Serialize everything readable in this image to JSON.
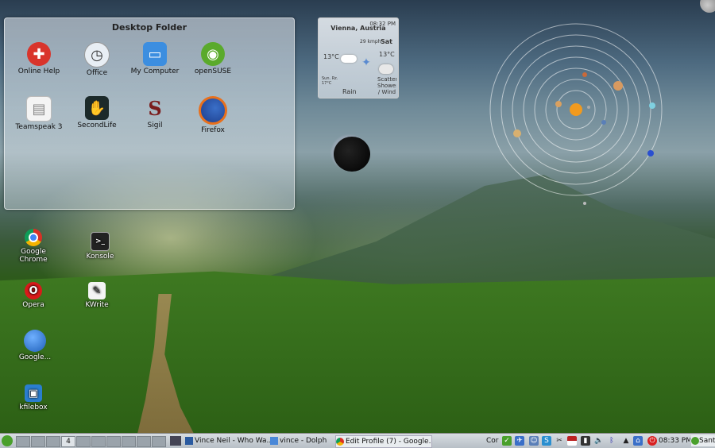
{
  "desktop_folder": {
    "title": "Desktop Folder",
    "icons": [
      {
        "label": "Online Help",
        "icon": "lifebuoy-icon",
        "color": "#d9342b"
      },
      {
        "label": "Office",
        "icon": "clock-icon",
        "color": "#dde6f0"
      },
      {
        "label": "My Computer",
        "icon": "monitor-icon",
        "color": "#3c8ee0"
      },
      {
        "label": "openSUSE",
        "icon": "opensuse-icon",
        "color": "#5aaa2c"
      },
      {
        "label": "Teamspeak 3",
        "icon": "document-icon",
        "color": "#f0f0f0"
      },
      {
        "label": "SecondLife",
        "icon": "hand-icon",
        "color": "#1c2a2a"
      },
      {
        "label": "Sigil",
        "icon": "sigil-icon",
        "color": "#7a1c1c"
      },
      {
        "label": "Firefox",
        "icon": "firefox-icon",
        "color": "#e8701c"
      }
    ]
  },
  "desktop_icons": [
    {
      "label": "Google Chrome",
      "icon": "chrome-icon",
      "color": "#e8e8e8"
    },
    {
      "label": "Konsole",
      "icon": "terminal-icon",
      "color": "#222"
    },
    {
      "label": "Opera",
      "icon": "opera-icon",
      "color": "#d91a1a"
    },
    {
      "label": "KWrite",
      "icon": "pen-icon",
      "color": "#f4f4f4"
    },
    {
      "label": "Google...",
      "icon": "earth-icon",
      "color": "#1e5fb8"
    },
    {
      "label": "kfilebox",
      "icon": "box-icon",
      "color": "#2a7ed0"
    }
  ],
  "weather": {
    "city": "Vienna, Austria",
    "time": "08:32 PM",
    "wind_speed": "29 kmph",
    "day": "Sat",
    "temp_left": "13°C",
    "temp_right": "13°C",
    "sun_text": "Sun. Rz. 17°C",
    "rain_label": "Rain",
    "condition": "Scattered Showers / Wind"
  },
  "taskbar": {
    "pager_current": "4",
    "tasks": [
      "Vince Neil - Who Wa...",
      "vince - Dolphin",
      "Edit Profile (7) - Google..."
    ],
    "clock": "08:33 PM",
    "tray_labels": [
      "Cor",
      "Santi"
    ]
  },
  "colors": {
    "taskbar_bg": "#c9d0d6",
    "folder_bg": "rgba(230,236,242,0.55)"
  }
}
